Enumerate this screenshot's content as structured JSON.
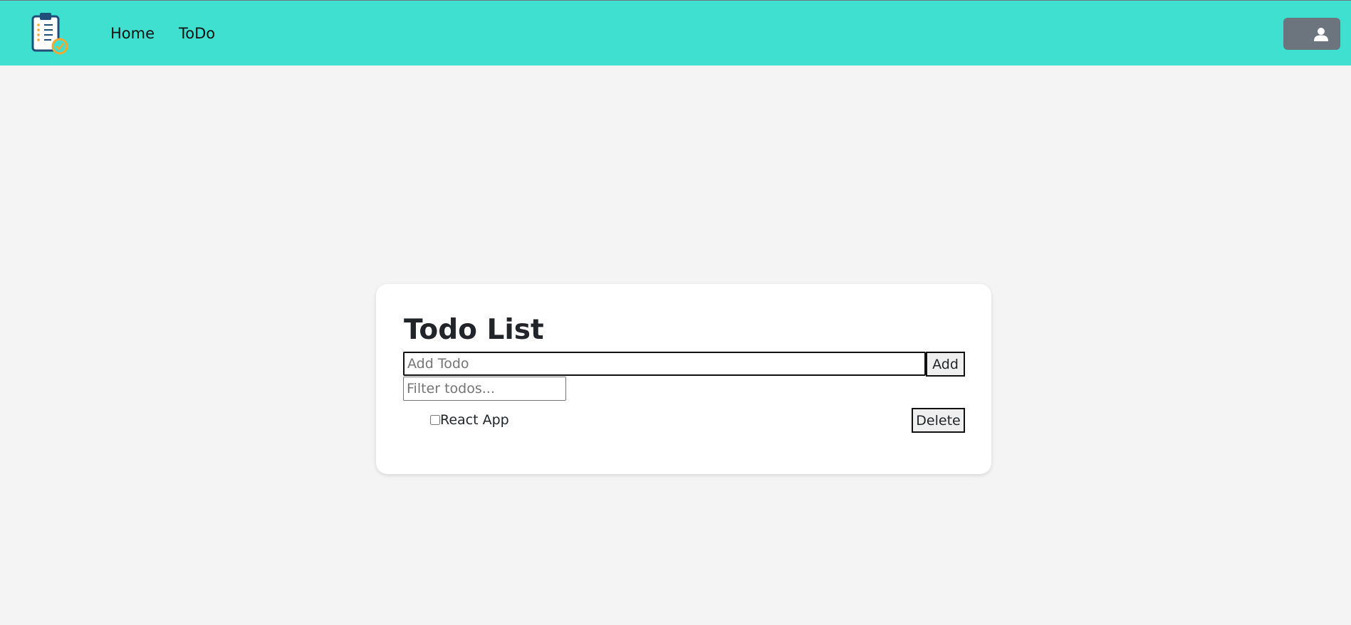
{
  "navbar": {
    "logo_icon": "clipboard-check-icon",
    "links": [
      {
        "label": "Home"
      },
      {
        "label": "ToDo"
      }
    ],
    "user_icon": "user-icon",
    "background": "#40e0d0",
    "user_button_color": "#6c757d"
  },
  "todo": {
    "title": "Todo List",
    "add_placeholder": "Add Todo",
    "add_value": "",
    "add_label": "Add",
    "filter_placeholder": "Filter todos...",
    "filter_value": "",
    "items": [
      {
        "label": "React App",
        "checked": false,
        "delete_label": "Delete"
      }
    ]
  }
}
